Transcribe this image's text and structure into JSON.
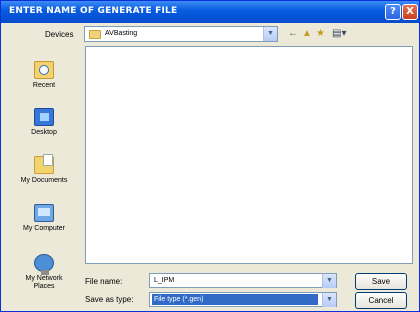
{
  "window": {
    "title": "ENTER NAME OF GENERATE FILE",
    "help_label": "?",
    "close_label": "X"
  },
  "lookin": {
    "label": "Devices",
    "value": "AVBasting"
  },
  "toolbar": {
    "back_label": "←",
    "up_label": "▲",
    "newfolder_label": "★",
    "views_label": "▤▾"
  },
  "places": [
    {
      "label": "Recent",
      "icon": "recent-documents-icon"
    },
    {
      "label": "Desktop",
      "icon": "desktop-icon"
    },
    {
      "label": "My Documents",
      "icon": "my-documents-icon"
    },
    {
      "label": "My Computer",
      "icon": "my-computer-icon"
    },
    {
      "label": "My Network Places",
      "icon": "network-places-icon"
    }
  ],
  "filename": {
    "label": "File name:",
    "value": "L_IPM"
  },
  "filetype": {
    "label": "Save as type:",
    "value": "File type (*.gen)"
  },
  "buttons": {
    "save": "Save",
    "cancel": "Cancel"
  },
  "colors": {
    "titlebar": "#0a5ee0",
    "selection": "#316ac5",
    "window_bg": "#ece9d8"
  }
}
